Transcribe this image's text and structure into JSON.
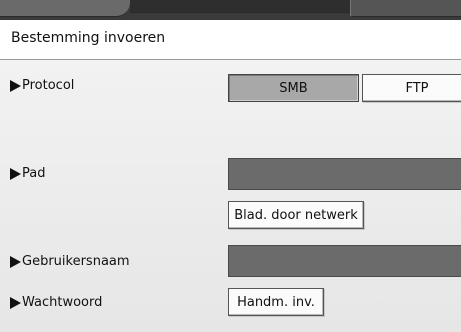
{
  "title": "Bestemming invoeren",
  "protocol": {
    "label": "Protocol",
    "options": [
      "SMB",
      "FTP"
    ],
    "selected": "SMB"
  },
  "path": {
    "label": "Pad",
    "browse_button": "Blad. door netwerk"
  },
  "username": {
    "label": "Gebruikersnaam"
  },
  "password": {
    "label": "Wachtwoord",
    "manual_input_button": "Handm. inv."
  },
  "colors": {
    "selected_button": "#a8a8a8",
    "input_field": "#6b6b6b",
    "background": "#ececec"
  }
}
